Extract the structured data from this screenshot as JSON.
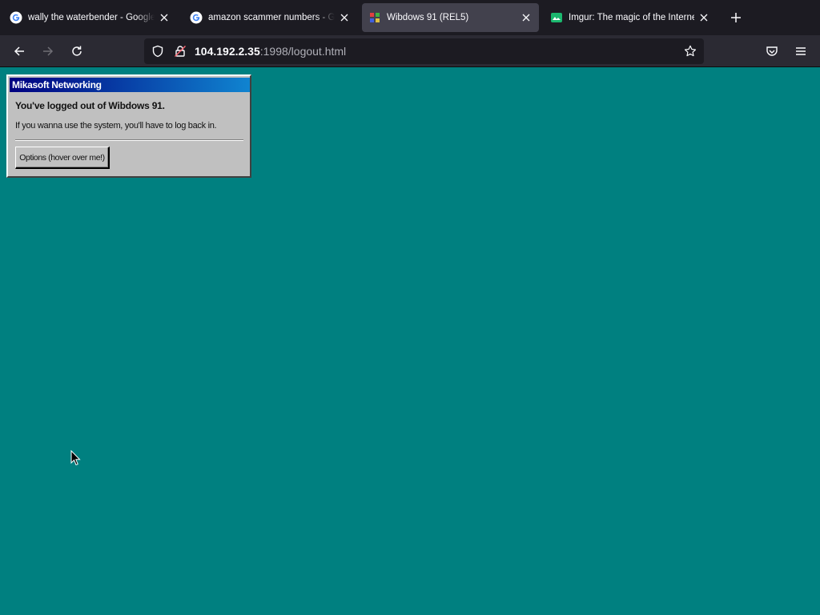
{
  "browser": {
    "tabs": [
      {
        "title": "wally the waterbender - Google",
        "favicon": "google-g-icon",
        "active": false
      },
      {
        "title": "amazon scammer numbers - Go",
        "favicon": "google-g-icon",
        "active": false
      },
      {
        "title": "Wibdows 91 (REL5)",
        "favicon": "wibdows-icon",
        "active": true
      },
      {
        "title": "Imgur: The magic of the Internet",
        "favicon": "imgur-icon",
        "active": false
      }
    ],
    "url_host": "104.192.2.35",
    "url_rest": ":1998/logout.html"
  },
  "dialog": {
    "title": "Mikasoft Networking",
    "heading": "You've logged out of Wibdows 91.",
    "message": "If you wanna use the system, you'll have to log back in.",
    "button_label": "Options (hover over me!)"
  },
  "colors": {
    "desktop": "#008080",
    "titlebar_start": "#000080",
    "titlebar_end": "#1084d0",
    "dialog_face": "#c0c0c0"
  }
}
